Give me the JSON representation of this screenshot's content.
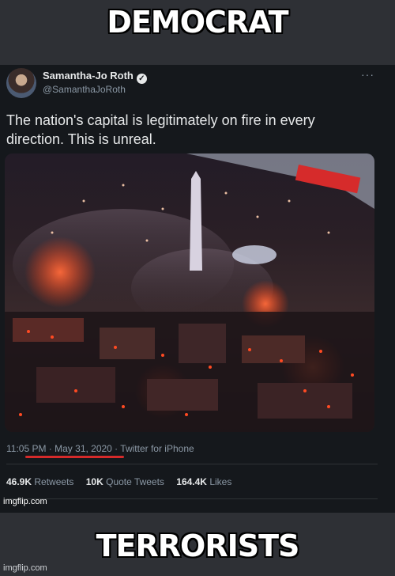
{
  "meme": {
    "top_text": "DEMOCRAT",
    "bottom_text": "TERRORISTS",
    "watermark": "imgflip.com"
  },
  "tweet": {
    "name": "Samantha-Jo Roth",
    "handle": "@SamanthaJoRoth",
    "more_icon": "···",
    "text": "The nation's capital is legitimately on fire in every direction. This is unreal.",
    "timestamp": "11:05 PM · May 31, 2020 · Twitter for iPhone",
    "stats": [
      {
        "value": "46.9K",
        "label": "Retweets"
      },
      {
        "value": "10K",
        "label": "Quote Tweets"
      },
      {
        "value": "164.4K",
        "label": "Likes"
      }
    ],
    "accent_red": "#d52a2a"
  },
  "image": {
    "subject": "night-aerial-city-fires-washington-monument",
    "icon": "photo-icon"
  }
}
